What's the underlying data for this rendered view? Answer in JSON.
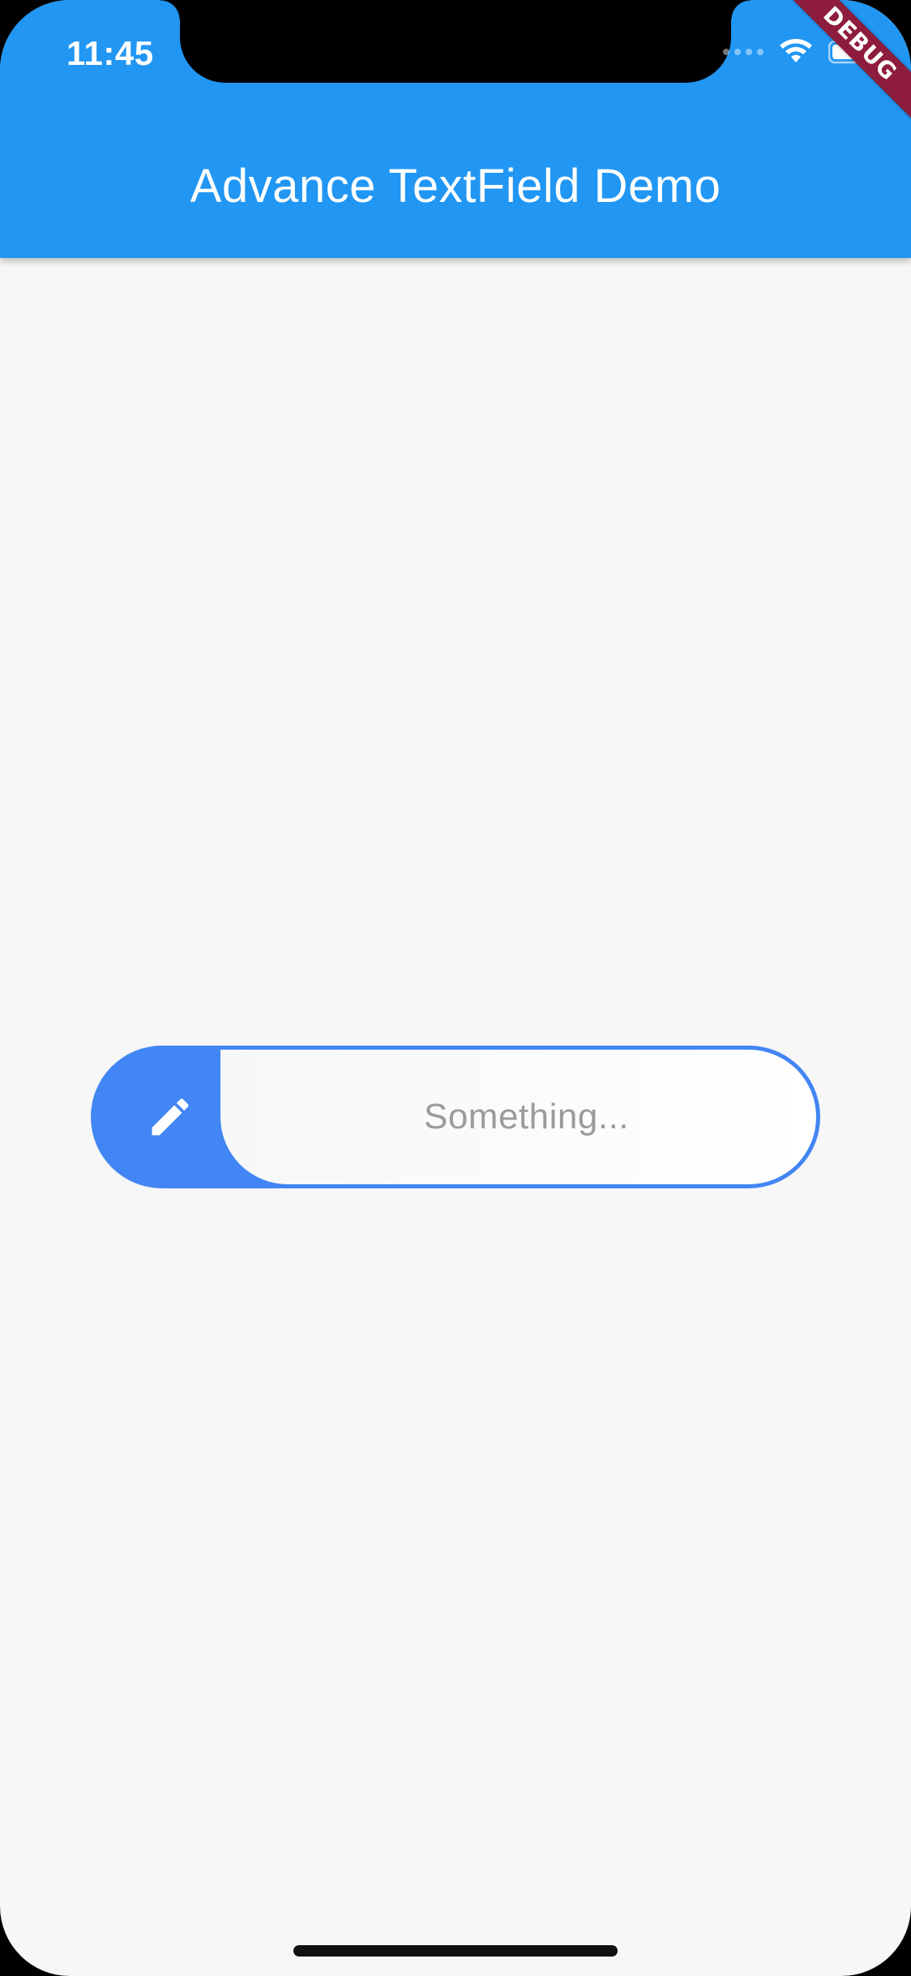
{
  "status_bar": {
    "time": "11:45",
    "icons": [
      "signal-dots-icon",
      "wifi-icon",
      "battery-icon"
    ]
  },
  "debug_banner": {
    "label": "DEBUG",
    "color": "#8e1c3c"
  },
  "app_bar": {
    "title": "Advance TextField Demo",
    "color": "#2196f3"
  },
  "text_field": {
    "placeholder": "Something...",
    "value": "",
    "icon": "pencil-icon",
    "accent_color": "#4285f4"
  },
  "colors": {
    "background": "#f7f7f7",
    "placeholder_text": "#9b9b9b"
  }
}
